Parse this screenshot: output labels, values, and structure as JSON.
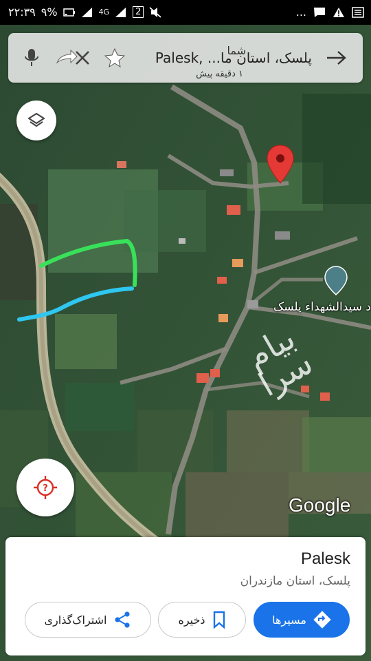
{
  "status_bar": {
    "time": "۲۲:۳۹",
    "battery": "۹%",
    "network": "4G",
    "sim_slot": "2",
    "icons": [
      "battery-icon",
      "signal-icon",
      "network-4g-icon",
      "signal-icon",
      "sim2-icon",
      "muted-icon",
      "more-dots-icon",
      "chat-icon",
      "warning-icon",
      "list-icon"
    ]
  },
  "search": {
    "main_text": "Palesk, ...پلسک، استان ما",
    "overlay_sender": "شما",
    "overlay_time": "۱ دقیقه پیش",
    "icons": [
      "mic-icon",
      "reply-arrow-icon",
      "close-icon",
      "star-icon",
      "forward-arrow-icon"
    ]
  },
  "map": {
    "place_label": "د سیدالشهداء پلسک",
    "watermark": "بیام سرا",
    "attribution": "Google",
    "icons": [
      "layers-icon",
      "location-pin-icon",
      "mosque-icon",
      "locate-me-icon"
    ],
    "colors": {
      "pin": "#e53935",
      "green_line": "#39e05a",
      "blue_line": "#2fc6f0",
      "accent": "#1a73e8"
    }
  },
  "place_sheet": {
    "title": "Palesk",
    "subtitle": "پلسک، استان مازندران",
    "actions": {
      "directions": "مسیرها",
      "save": "ذخیره",
      "share": "اشتراک‌گذاری"
    },
    "icons": [
      "directions-icon",
      "bookmark-icon",
      "share-icon"
    ]
  }
}
